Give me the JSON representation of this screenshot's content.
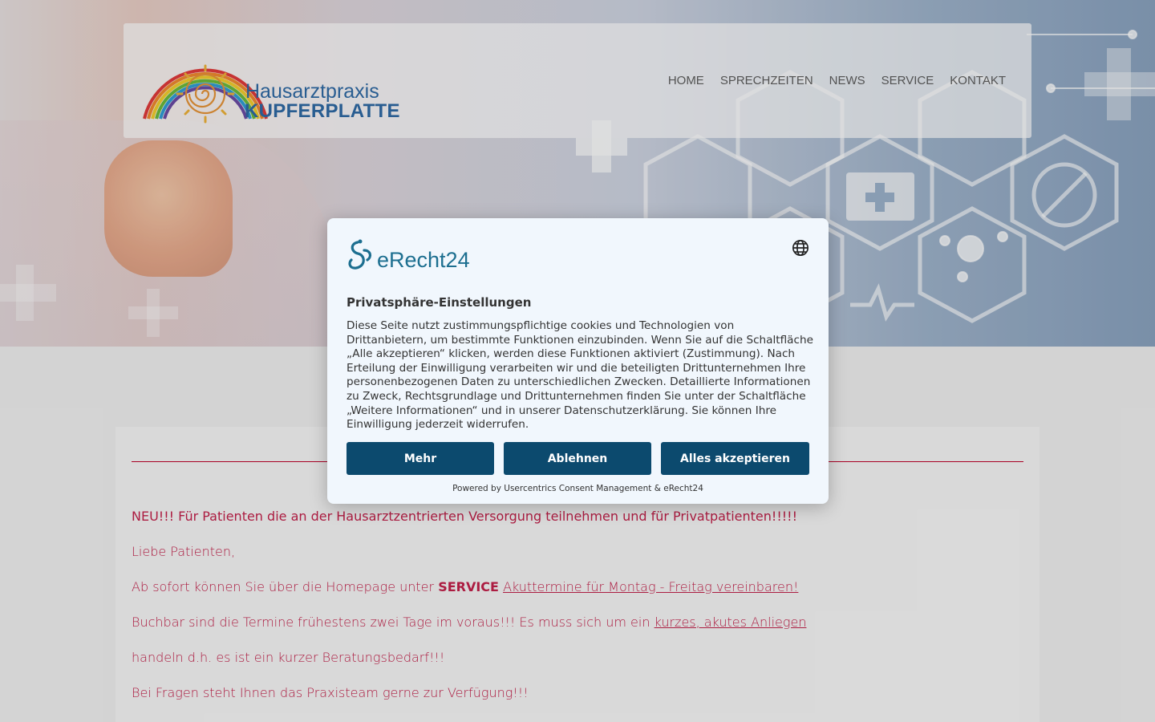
{
  "site": {
    "logo": {
      "line1": "Hausarztpraxis",
      "line2": "KUPFERPLATTE"
    },
    "menu": [
      "HOME",
      "SPRECHZEITEN",
      "NEWS",
      "SERVICE",
      "KONTAKT"
    ]
  },
  "content": {
    "headline": "NEU!!! Für Patienten die an der Hausarztzentrierten Versorgung teilnehmen und für Privatpatienten!!!!!",
    "greeting": "Liebe Patienten,",
    "line2_prefix": "Ab sofort können Sie über die Homepage unter ",
    "line2_bold": "SERVICE",
    "line2_link": "Akuttermine für Montag - Freitag vereinbaren!",
    "line3_prefix": "Buchbar sind die Termine frühestens zwei Tage im voraus!!! Es muss sich um ein ",
    "line3_link": "kurzes, akutes Anliegen",
    "line4": "handeln d.h. es ist ein kurzer Beratungsbedarf!!!",
    "line5": "Bei Fragen steht Ihnen das Praxisteam gerne zur Verfügung!!!"
  },
  "consent": {
    "brand": "eRecht24",
    "title": "Privatsphäre-Einstellungen",
    "body": "Diese Seite nutzt zustimmungspflichtige cookies und Technologien von Drittanbietern, um bestimmte Funktionen einzubinden. Wenn Sie auf die Schaltfläche „Alle akzeptieren“ klicken, werden diese Funktionen aktiviert (Zustimmung). Nach Erteilung der Einwilligung verarbeiten wir und die beteiligten Drittunternehmen Ihre personenbezogenen Daten zu unterschiedlichen Zwecken. Detaillierte Informationen zu Zweck, Rechtsgrundlage und Drittunternehmen finden Sie unter der Schaltfläche „Weitere Informationen“ und in unserer Datenschutzerklärung. Sie können Ihre Einwilligung jederzeit widerrufen.",
    "buttons": {
      "more": "Mehr",
      "decline": "Ablehnen",
      "accept": "Alles akzeptieren"
    },
    "powered": "Powered by Usercentrics Consent Management & eRecht24",
    "colors": {
      "button": "#0c4a6e",
      "background": "#f1f7fd",
      "brand": "#1d6f90"
    }
  },
  "icons": [
    "globe-icon",
    "erecht24-logo-icon",
    "rainbow-sun-logo-icon"
  ]
}
